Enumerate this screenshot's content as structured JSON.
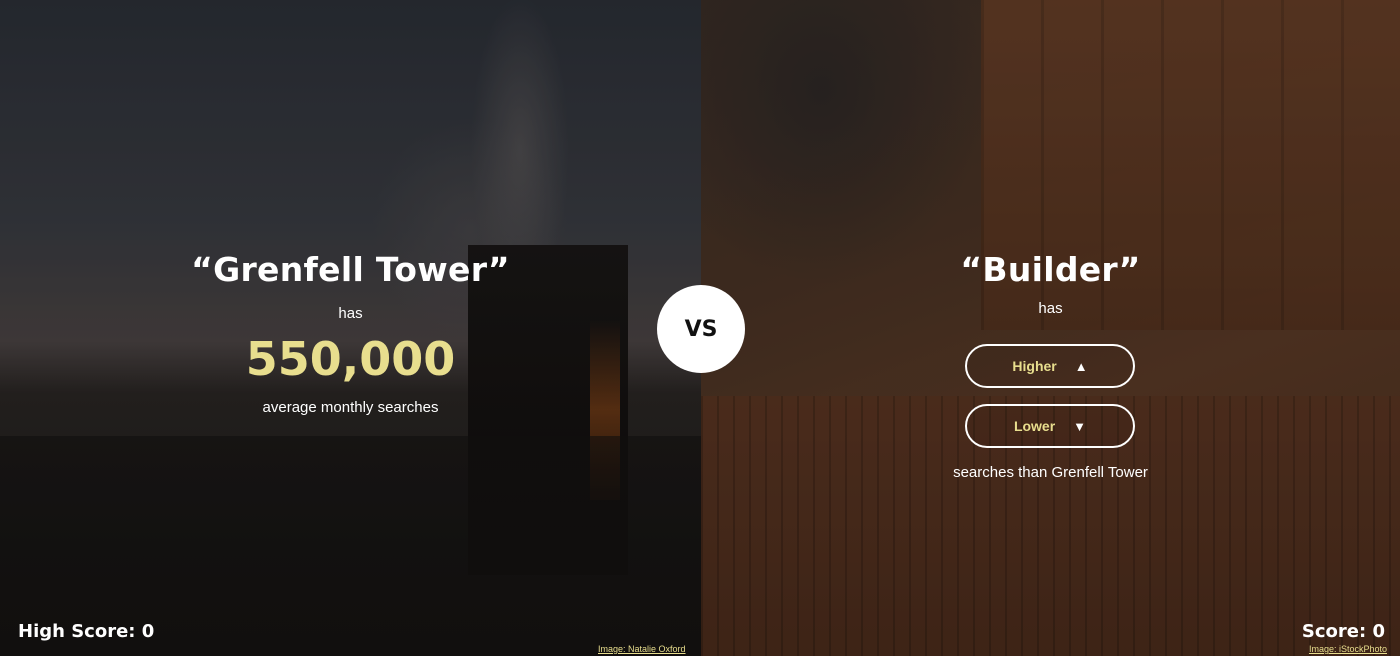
{
  "left": {
    "term": "“Grenfell Tower”",
    "has": "has",
    "value": "550,000",
    "description": "average monthly searches",
    "image_credit": "Image: Natalie Oxford"
  },
  "right": {
    "term": "“Builder”",
    "has": "has",
    "higher_label": "Higher",
    "higher_icon": "triangle-up-icon",
    "lower_label": "Lower",
    "lower_icon": "triangle-down-icon",
    "comparison_text": "searches than Grenfell Tower",
    "image_credit": "Image: iStockPhoto"
  },
  "vs_label": "VS",
  "high_score": "High Score: 0",
  "score": "Score: 0",
  "colors": {
    "accent": "#e8de8e",
    "text": "#ffffff",
    "vs_circle": "#ffffff"
  }
}
